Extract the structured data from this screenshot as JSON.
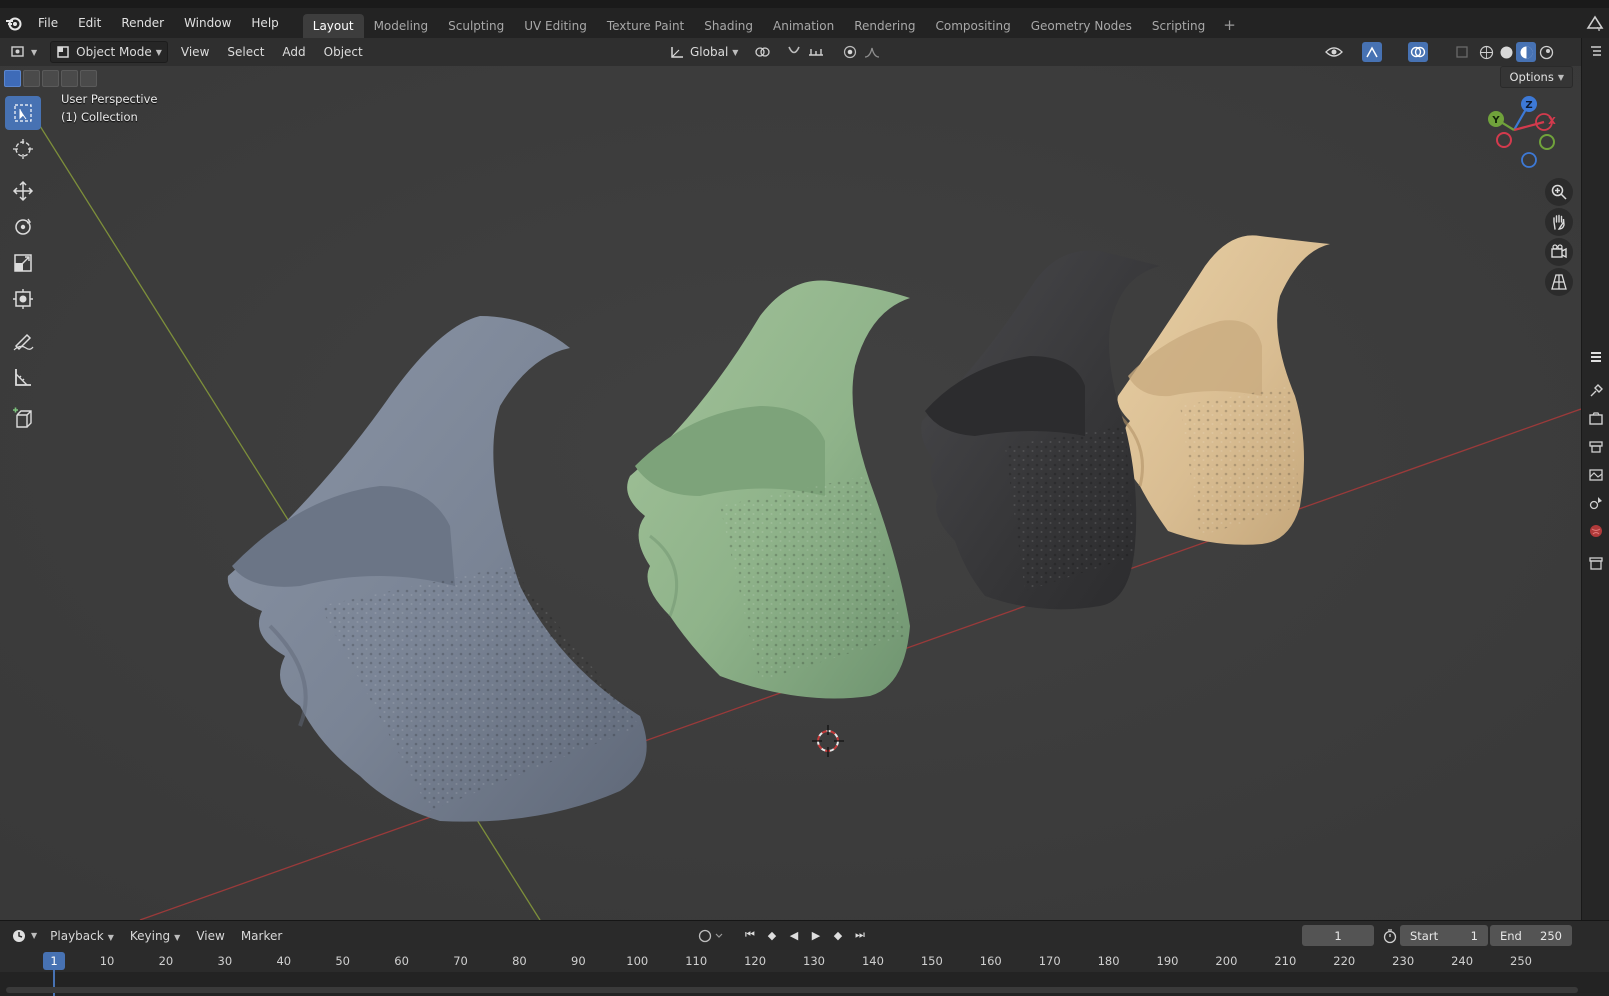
{
  "menubar": {
    "items": [
      "File",
      "Edit",
      "Render",
      "Window",
      "Help"
    ],
    "workspaces": [
      "Layout",
      "Modeling",
      "Sculpting",
      "UV Editing",
      "Texture Paint",
      "Shading",
      "Animation",
      "Rendering",
      "Compositing",
      "Geometry Nodes",
      "Scripting"
    ],
    "active_workspace": "Layout",
    "add_tab": "+"
  },
  "viewport_header": {
    "mode": "Object Mode",
    "menus": [
      "View",
      "Select",
      "Add",
      "Object"
    ],
    "transform_orientation": "Global"
  },
  "viewport": {
    "view_name": "User Perspective",
    "collection": "(1) Collection",
    "options_label": "Options",
    "gizmo_axes": {
      "z": "Z",
      "y": "Y",
      "x": "X"
    },
    "object_colors": {
      "grey": "#7b8596",
      "green": "#8fb38a",
      "black": "#3b3b3d",
      "tan": "#d9bd92"
    }
  },
  "timeline": {
    "menus": [
      "Playback",
      "Keying",
      "View",
      "Marker"
    ],
    "current_frame": "1",
    "start_label": "Start",
    "start_value": "1",
    "end_label": "End",
    "end_value": "250",
    "playhead": "1",
    "ruler_ticks": [
      "10",
      "20",
      "30",
      "40",
      "50",
      "60",
      "70",
      "80",
      "90",
      "100",
      "110",
      "120",
      "130",
      "140",
      "150",
      "160",
      "170",
      "180",
      "190",
      "200",
      "210",
      "220",
      "230",
      "240",
      "250"
    ]
  },
  "accent_color": "#4772b3"
}
